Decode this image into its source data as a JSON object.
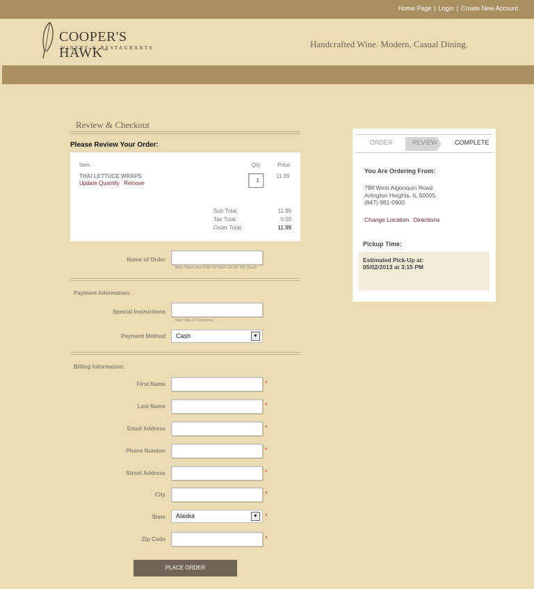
{
  "header": {
    "links": [
      "Home Page",
      "Login",
      "Create New Account"
    ],
    "brand_name": "COOPER'S HAWK",
    "brand_tm": "™",
    "brand_sub": "WINERY & RESTAURANTS",
    "tagline": "Handcrafted Wine. Modern, Casual Dining."
  },
  "page": {
    "title": "Review & Checkout",
    "review_heading": "Please Review Your Order:"
  },
  "order": {
    "columns": {
      "item": "Item",
      "qty": "Qty",
      "price": "Price"
    },
    "item": {
      "name": "THAI LETTUCE WRAPS",
      "update": "Update Quantity",
      "remove": "Remove",
      "qty": "1",
      "price": "11.99"
    },
    "totals": [
      {
        "label": "Sub Total:",
        "value": "11.99"
      },
      {
        "label": "Tax Total:",
        "value": "0.00"
      },
      {
        "label": "Order Total:",
        "value": "11.99"
      }
    ]
  },
  "form": {
    "name_of_order_label": "Name of Order",
    "name_of_order_note": "Note:  Name your Order for future use (ie. The Usual)",
    "payment_section": "Payment Information:",
    "special_label": "Special Instructions",
    "special_note": "Note:  Max 24 Characters",
    "payment_method_label": "Payment Method",
    "payment_method_value": "Cash",
    "billing_section": "Billing Information:",
    "first_name": "First Name",
    "last_name": "Last Name",
    "email": "Email Address",
    "phone": "Phone Number",
    "street": "Street Address",
    "city": "City",
    "state": "State",
    "state_value": "Alaska",
    "zip": "Zip Code",
    "required_mark": "*",
    "place_order": "PLACE ORDER"
  },
  "panel": {
    "steps": [
      "ORDER",
      "REVIEW",
      "COMPLETE"
    ],
    "ordering_from": "You Are Ordering From:",
    "address_line1": "798 West Algonquin Road",
    "address_line2": "Arlington Heights, IL 60005",
    "phone": "(847) 981-0900",
    "change_location": "Change Location",
    "directions": "Directions",
    "pickup_time": "Pickup Time:",
    "estimated_label": "Estimated Pick-Up at:",
    "estimated_value": "05/02/2013 at 3:15 PM"
  },
  "colors": {
    "topbar": "#a98f62",
    "background": "#ebdcb4",
    "link": "#7a1f2e",
    "button": "#6f6658"
  }
}
